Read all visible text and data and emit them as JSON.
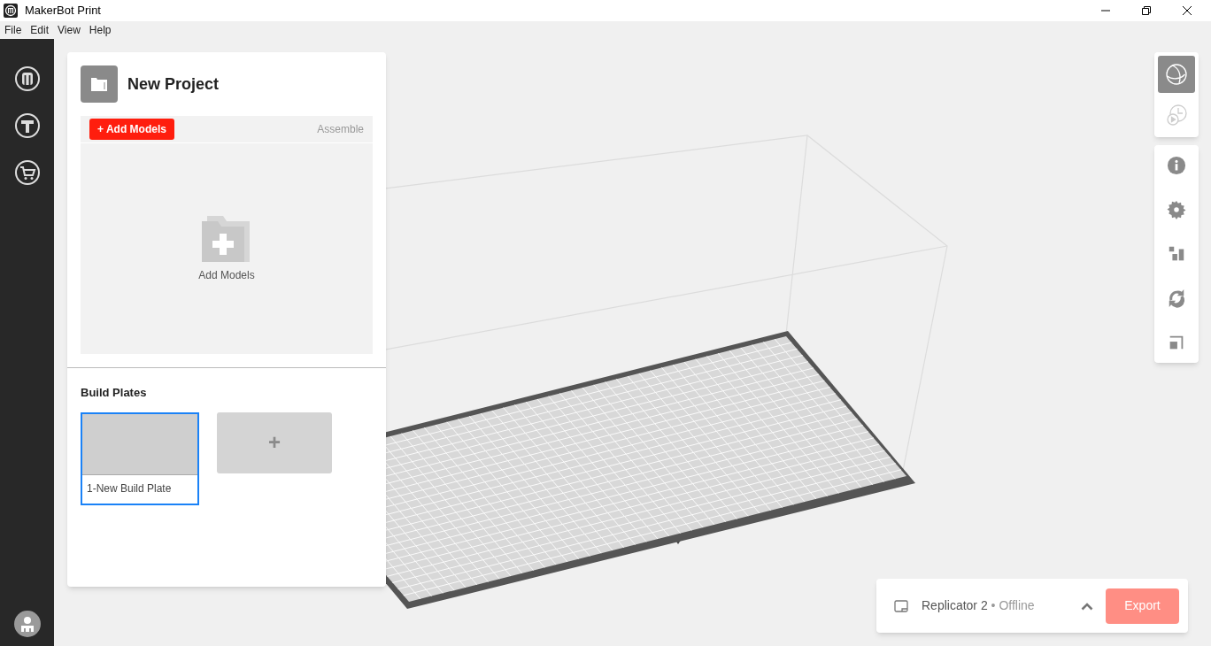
{
  "window": {
    "title": "MakerBot Print"
  },
  "menu": [
    "File",
    "Edit",
    "View",
    "Help"
  ],
  "project": {
    "title": "New Project",
    "add_button": "+ Add Models",
    "tab": "Assemble",
    "empty_label": "Add Models"
  },
  "build_plates": {
    "heading": "Build Plates",
    "plates": [
      {
        "label": "1-New Build Plate",
        "selected": true
      }
    ],
    "add_label": "+"
  },
  "view_modes": [
    {
      "selected": true
    },
    {
      "selected": false
    }
  ],
  "printer": {
    "name": "Replicator 2",
    "separator": "•",
    "status": "Offline",
    "export": "Export",
    "export_disabled": true
  }
}
